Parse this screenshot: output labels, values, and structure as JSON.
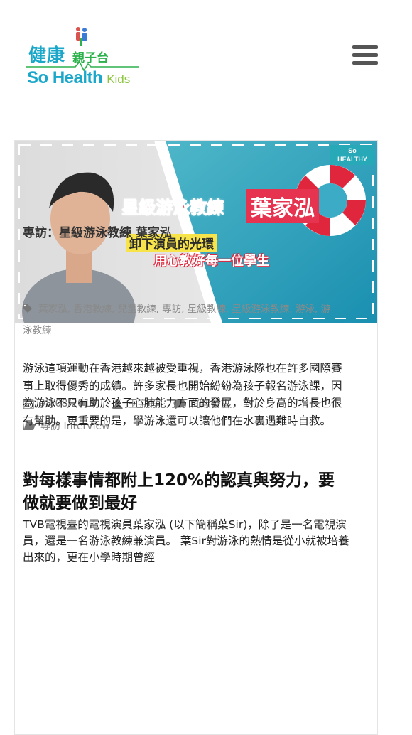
{
  "header": {
    "logo_cn_big": "健康",
    "logo_cn_small": "親子台",
    "logo_en_big": "So Health",
    "logo_en_small": "Kids",
    "menu_icon": "hamburger-menu-icon"
  },
  "banner": {
    "title": "星級游泳教練",
    "name": "葉家泓",
    "subtitle1": "卸下演員的光環",
    "subtitle2": "用心教好每一位學生",
    "badge_line1": "So",
    "badge_line2": "HEALTHY"
  },
  "post": {
    "title": "專訪：星級游泳教練 葉家泓",
    "date": "08/08/2019",
    "author": "王宇旁",
    "comments": "尚無留言",
    "category": "專訪 Interview",
    "tags": "葉家泓, 香港教練, 兒童教練, 專訪, 星級教練, 星級游泳教練, 游泳, 游泳教練",
    "paragraph1": "游泳這項運動在香港越來越被受重視，香港游泳隊也在許多國際賽事上取得優秀的成績。許多家長也開始紛紛為孩子報名游泳課，因為游泳不只有助於孩子心肺能力方面的發展，對於身高的增長也很有幫助。更重要的是，學游泳還可以讓他們在水裏遇難時自救。",
    "heading": "對每樣事情都附上120%的認真與努力，要做就要做到最好",
    "paragraph2": "TVB電視臺的電視演員葉家泓 (以下簡稱葉Sir)，除了是一名電視演員，還是一名游泳教練兼演員。 葉Sir對游泳的熱情是從小就被培養出來的，更在小學時期曾經"
  },
  "colors": {
    "brand_blue": "#1aa7c9",
    "brand_green": "#2bb24c",
    "banner_red": "#e0263c",
    "meta_grey": "#777777"
  }
}
